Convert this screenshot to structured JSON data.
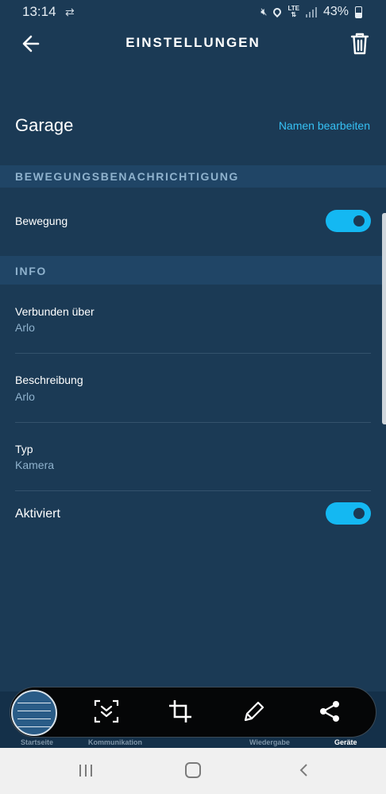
{
  "status_bar": {
    "time": "13:14",
    "network": "LTE",
    "battery": "43%",
    "icons": [
      "sync-icon",
      "mute-icon",
      "location-icon",
      "signal-icon",
      "battery-icon"
    ]
  },
  "header": {
    "title": "EINSTELLUNGEN",
    "back_icon": "arrow-left-icon",
    "delete_icon": "trash-icon"
  },
  "device": {
    "name": "Garage",
    "edit_label": "Namen bearbeiten"
  },
  "motion_section": {
    "header": "BEWEGUNGSBENACHRICHTIGUNG",
    "motion_label": "Bewegung",
    "motion_enabled": true
  },
  "info_section": {
    "header": "INFO",
    "items": [
      {
        "label": "Verbunden über",
        "value": "Arlo"
      },
      {
        "label": "Beschreibung",
        "value": "Arlo"
      },
      {
        "label": "Typ",
        "value": "Kamera"
      }
    ],
    "activated_label": "Aktiviert",
    "activated_enabled": true
  },
  "bottom_nav": {
    "items": [
      {
        "label": "Startseite",
        "active": false
      },
      {
        "label": "Kommunikation",
        "active": false
      },
      {
        "label": "Wiedergabe",
        "active": false
      },
      {
        "label": "Geräte",
        "active": true
      }
    ]
  },
  "screenshot_toolbar": {
    "tools": [
      "scroll-capture-icon",
      "crop-icon",
      "draw-icon",
      "share-icon"
    ]
  },
  "system_nav": {
    "buttons": [
      "recents-icon",
      "home-icon",
      "back-icon"
    ]
  },
  "colors": {
    "background": "#1b3a55",
    "section_header": "#204566",
    "accent": "#36c1f5",
    "toggle": "#14b8f2",
    "muted_text": "#8fb2cd"
  }
}
